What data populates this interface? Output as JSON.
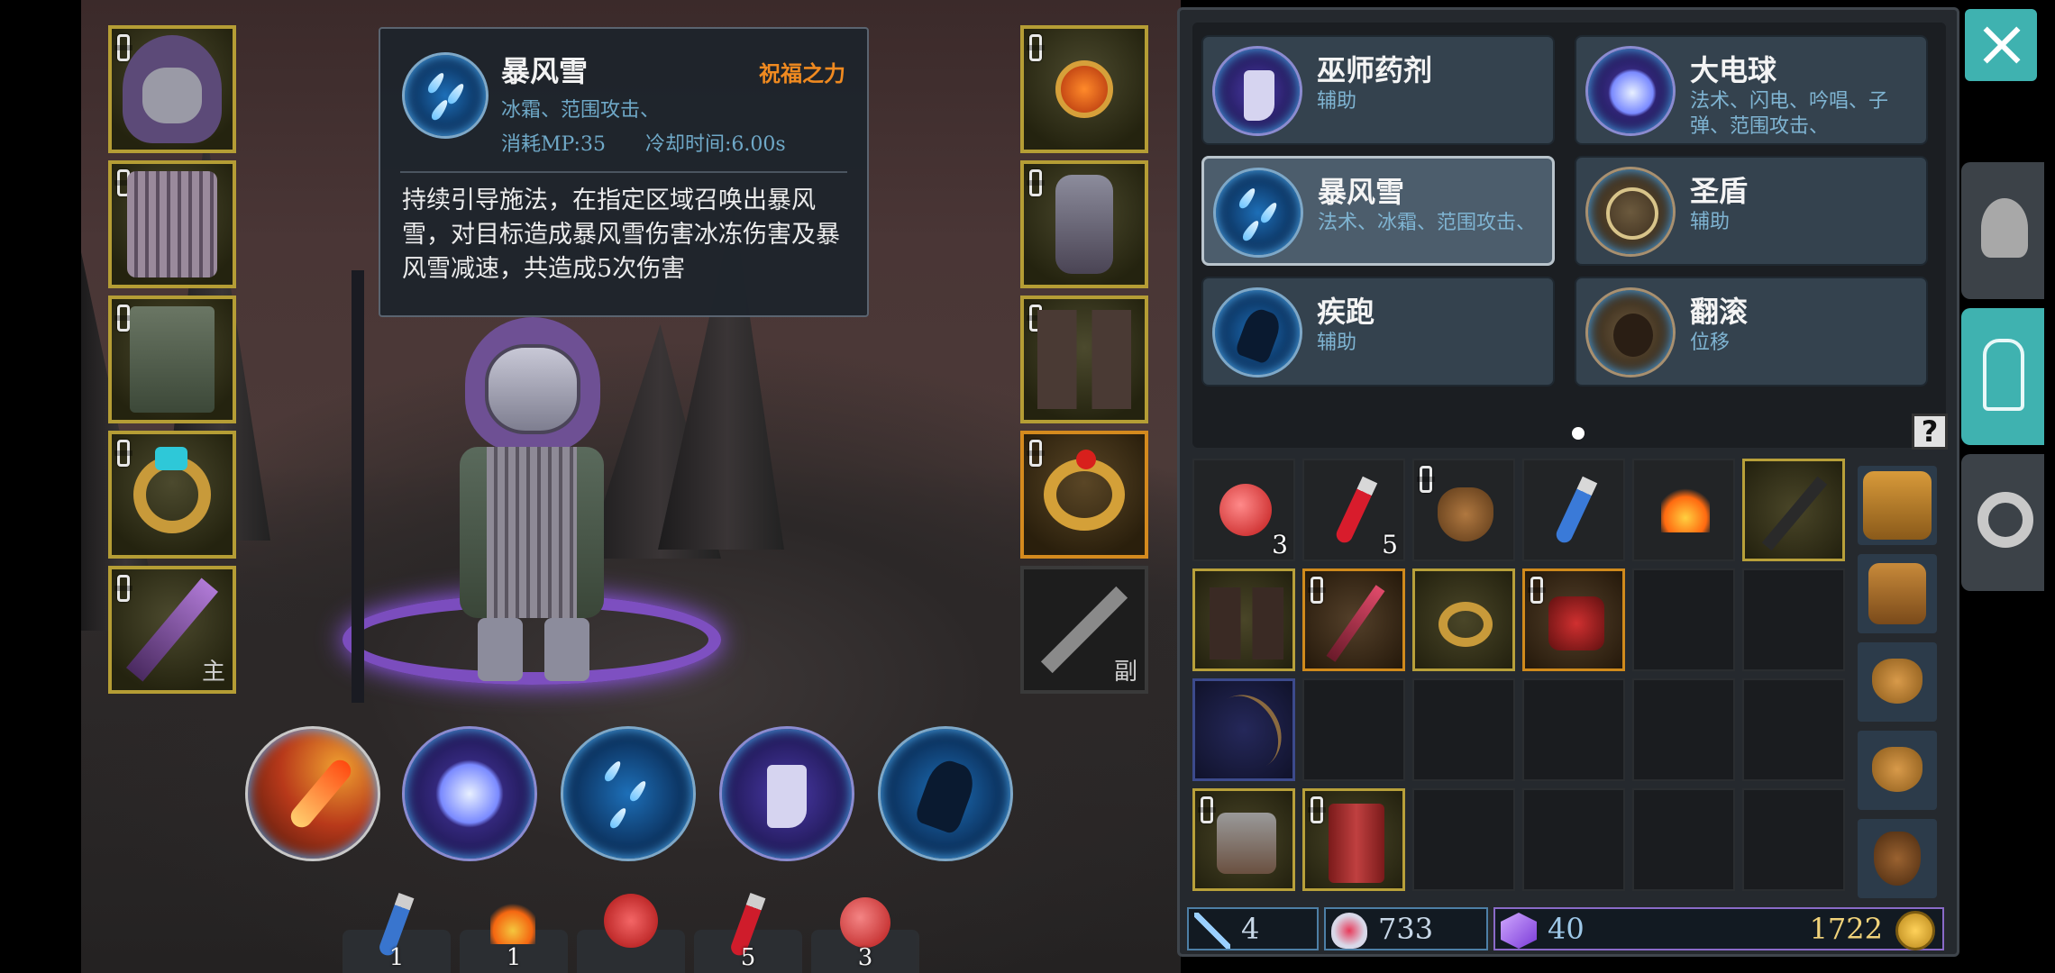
{
  "tooltip": {
    "skill_name": "暴风雪",
    "tag": "祝福之力",
    "types": "冰霜、范围攻击、",
    "cost": "消耗MP:35",
    "cooldown": "冷却时间:6.00s",
    "description": "持续引导施法，在指定区域召唤出暴风雪，对目标造成暴风雪伤害冰冻伤害及暴风雪减速，共造成5次伤害"
  },
  "equipment": {
    "weapon_main_tag": "主",
    "weapon_off_tag": "副"
  },
  "skills": [
    {
      "name": "巫师药剂",
      "tags": "辅助",
      "icon": "boot-icon"
    },
    {
      "name": "大电球",
      "tags": "法术、闪电、吟唱、子弹、范围攻击、",
      "icon": "lightning-ball-icon"
    },
    {
      "name": "暴风雪",
      "tags": "法术、冰霜、范围攻击、",
      "icon": "blizzard-icon",
      "selected": true
    },
    {
      "name": "圣盾",
      "tags": "辅助",
      "icon": "holy-shield-icon"
    },
    {
      "name": "疾跑",
      "tags": "辅助",
      "icon": "sprint-icon"
    },
    {
      "name": "翻滚",
      "tags": "位移",
      "icon": "roll-icon"
    }
  ],
  "help_label": "?",
  "inventory": {
    "row0": [
      {
        "name": "red-potion",
        "qty": "3"
      },
      {
        "name": "red-vial",
        "qty": "5"
      },
      {
        "name": "pouch",
        "qty": ""
      },
      {
        "name": "blue-vial",
        "qty": ""
      },
      {
        "name": "campfire",
        "qty": ""
      },
      {
        "name": "dagger",
        "qty": ""
      }
    ]
  },
  "consumables": [
    {
      "icon": "blue-vial-icon",
      "qty": "1"
    },
    {
      "icon": "campfire-icon",
      "qty": "1"
    },
    {
      "icon": "red-flask-icon",
      "qty": ""
    },
    {
      "icon": "red-vial-icon",
      "qty": "5"
    },
    {
      "icon": "red-potion-icon",
      "qty": "3"
    }
  ],
  "currency": {
    "skill_points": "4",
    "health": "733",
    "gems": "40",
    "gold": "1722"
  },
  "colors": {
    "accent_teal": "#3fb2b0",
    "item_gold": "#b59d35",
    "tag_orange": "#f08a20",
    "tag_blue": "#7fb4d2"
  }
}
